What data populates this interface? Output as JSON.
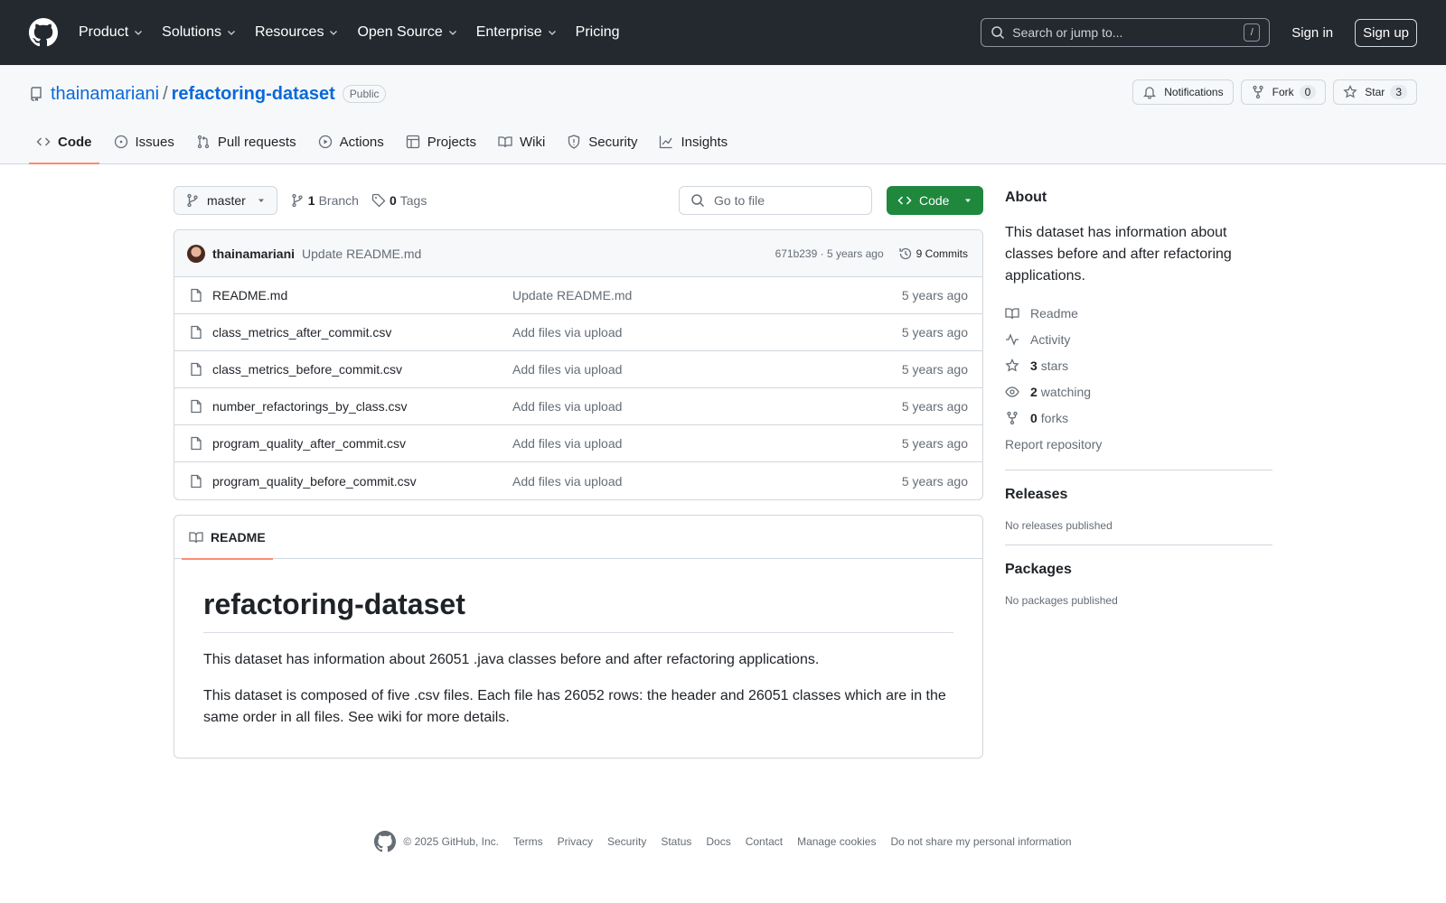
{
  "header": {
    "nav": [
      "Product",
      "Solutions",
      "Resources",
      "Open Source",
      "Enterprise",
      "Pricing"
    ],
    "search_placeholder": "Search or jump to...",
    "search_key": "/",
    "signin": "Sign in",
    "signup": "Sign up"
  },
  "repo": {
    "owner": "thainamariani",
    "separator": "/",
    "name": "refactoring-dataset",
    "visibility": "Public",
    "notifications_label": "Notifications",
    "fork_label": "Fork",
    "fork_count": "0",
    "star_label": "Star",
    "star_count": "3"
  },
  "tabs": [
    "Code",
    "Issues",
    "Pull requests",
    "Actions",
    "Projects",
    "Wiki",
    "Security",
    "Insights"
  ],
  "filebar": {
    "branch": "master",
    "branch_count": "1",
    "branch_label": "Branch",
    "tag_count": "0",
    "tag_label": "Tags",
    "goto_placeholder": "Go to file",
    "code_label": "Code"
  },
  "commit": {
    "author": "thainamariani",
    "message": "Update README.md",
    "meta": "671b239 · 5 years ago",
    "count_label": "9 Commits"
  },
  "files": [
    {
      "name": "README.md",
      "message": "Update README.md",
      "age": "5 years ago"
    },
    {
      "name": "class_metrics_after_commit.csv",
      "message": "Add files via upload",
      "age": "5 years ago"
    },
    {
      "name": "class_metrics_before_commit.csv",
      "message": "Add files via upload",
      "age": "5 years ago"
    },
    {
      "name": "number_refactorings_by_class.csv",
      "message": "Add files via upload",
      "age": "5 years ago"
    },
    {
      "name": "program_quality_after_commit.csv",
      "message": "Add files via upload",
      "age": "5 years ago"
    },
    {
      "name": "program_quality_before_commit.csv",
      "message": "Add files via upload",
      "age": "5 years ago"
    }
  ],
  "readme": {
    "tab_label": "README",
    "title": "refactoring-dataset",
    "p1": "This dataset has information about 26051 .java classes before and after refactoring applications.",
    "p2": "This dataset is composed of five .csv files. Each file has 26052 rows: the header and 26051 classes which are in the same order in all files. See wiki for more details."
  },
  "about": {
    "heading": "About",
    "description": "This dataset has information about classes before and after refactoring applications.",
    "readme_link": "Readme",
    "activity_link": "Activity",
    "stars_count": "3",
    "stars_label": "stars",
    "watching_count": "2",
    "watching_label": "watching",
    "forks_count": "0",
    "forks_label": "forks",
    "report_link": "Report repository"
  },
  "releases": {
    "heading": "Releases",
    "empty": "No releases published"
  },
  "packages": {
    "heading": "Packages",
    "empty": "No packages published"
  },
  "footer": {
    "copyright": "© 2025 GitHub, Inc.",
    "links": [
      "Terms",
      "Privacy",
      "Security",
      "Status",
      "Docs",
      "Contact",
      "Manage cookies",
      "Do not share my personal information"
    ]
  },
  "colors": {
    "header_bg": "#24292f",
    "link": "#0969da",
    "primary_button": "#1f883d",
    "active_tab_underline": "#fd8c73"
  }
}
